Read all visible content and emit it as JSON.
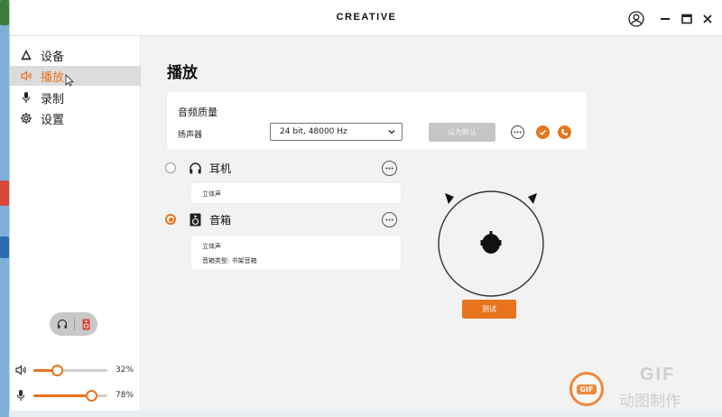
{
  "window": {
    "brand": "CREATIVE"
  },
  "sidebar": {
    "items": [
      {
        "label": "设备",
        "icon": "triangle-icon"
      },
      {
        "label": "播放",
        "icon": "speaker-icon",
        "active": true
      },
      {
        "label": "录制",
        "icon": "mic-icon"
      },
      {
        "label": "设置",
        "icon": "gear-icon"
      }
    ],
    "volume": {
      "label": "32%",
      "value": 0.32
    },
    "mic": {
      "label": "78%",
      "value": 0.78
    }
  },
  "main": {
    "title": "播放",
    "quality": {
      "title": "音频质量",
      "device_label": "扬声器",
      "format_value": "24 bit, 48000 Hz",
      "default_button": "设为默认"
    },
    "outputs": [
      {
        "label": "耳机",
        "selected": false,
        "details": [
          "立体声"
        ]
      },
      {
        "label": "音箱",
        "selected": true,
        "details": [
          "立体声",
          "音箱类型:   书架音箱"
        ]
      }
    ],
    "test_button": "测试"
  },
  "watermark": {
    "badge": "GIF",
    "line1": "GIF",
    "line2": "动图制作"
  },
  "colors": {
    "accent": "#e8741e",
    "sidebar_active_bg": "#dcdcdc"
  }
}
